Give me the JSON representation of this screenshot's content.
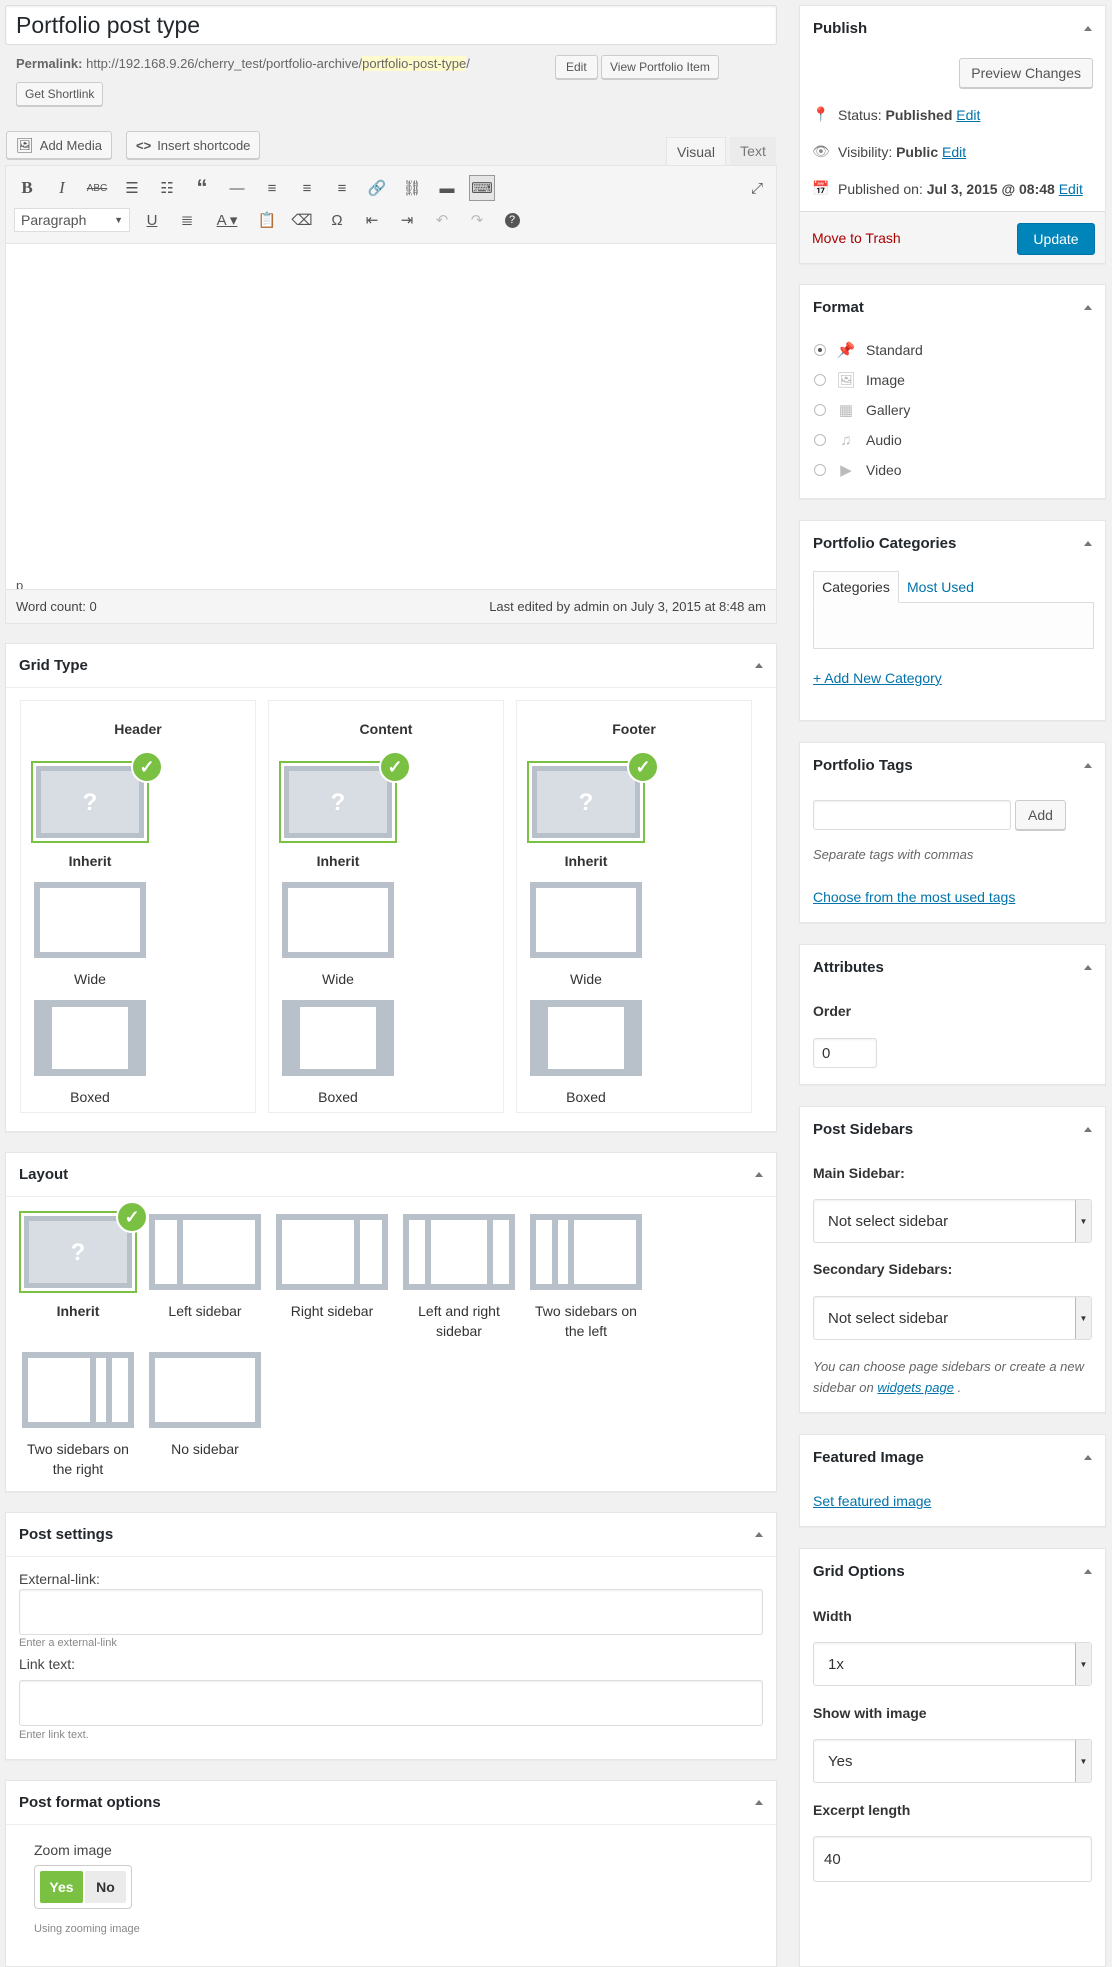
{
  "title": "Portfolio post type",
  "permalink": {
    "label": "Permalink:",
    "base": "http://192.168.9.26/cherry_test/portfolio-archive/",
    "slug": "portfolio-post-type",
    "trail": "/",
    "edit": "Edit",
    "view": "View Portfolio Item",
    "shortlink": "Get Shortlink"
  },
  "editor": {
    "add_media": "Add Media",
    "insert_shortcode": "Insert shortcode",
    "tab_visual": "Visual",
    "tab_text": "Text",
    "paragraph": "Paragraph",
    "path": "p",
    "word_count": "Word count: 0",
    "last_edited": "Last edited by admin on July 3, 2015 at 8:48 am"
  },
  "grid_type": {
    "title": "Grid Type",
    "columns": [
      {
        "name": "Header",
        "options": [
          "Inherit",
          "Wide",
          "Boxed"
        ]
      },
      {
        "name": "Content",
        "options": [
          "Inherit",
          "Wide",
          "Boxed"
        ]
      },
      {
        "name": "Footer",
        "options": [
          "Inherit",
          "Wide",
          "Boxed"
        ]
      }
    ]
  },
  "layout": {
    "title": "Layout",
    "options": [
      "Inherit",
      "Left sidebar",
      "Right sidebar",
      "Left and right sidebar",
      "Two sidebars on the left",
      "Two sidebars on the right",
      "No sidebar"
    ]
  },
  "post_settings": {
    "title": "Post settings",
    "external_label": "External-link:",
    "external_hint": "Enter a external-link",
    "link_label": "Link text:",
    "link_hint": "Enter link text."
  },
  "post_format_options": {
    "title": "Post format options",
    "zoom_label": "Zoom image",
    "yes": "Yes",
    "no": "No",
    "hint": "Using zooming image"
  },
  "publish": {
    "title": "Publish",
    "preview": "Preview Changes",
    "status_label": "Status:",
    "status_value": "Published",
    "visibility_label": "Visibility:",
    "visibility_value": "Public",
    "published_label": "Published on:",
    "published_value": "Jul 3, 2015 @ 08:48",
    "edit": "Edit",
    "trash": "Move to Trash",
    "update": "Update"
  },
  "format": {
    "title": "Format",
    "options": [
      "Standard",
      "Image",
      "Gallery",
      "Audio",
      "Video"
    ],
    "selected": "Standard"
  },
  "categories": {
    "title": "Portfolio Categories",
    "tab_all": "Categories",
    "tab_used": "Most Used",
    "add": "+ Add New Category"
  },
  "tags": {
    "title": "Portfolio Tags",
    "add": "Add",
    "hint": "Separate tags with commas",
    "choose": "Choose from the most used tags"
  },
  "attributes": {
    "title": "Attributes",
    "order_label": "Order",
    "order_value": "0"
  },
  "sidebars": {
    "title": "Post Sidebars",
    "main_label": "Main Sidebar:",
    "main_value": "Not select sidebar",
    "secondary_label": "Secondary Sidebars:",
    "secondary_value": "Not select sidebar",
    "hint_pre": "You can choose page sidebars or create a new sidebar on",
    "hint_link": "widgets page",
    "hint_post": "."
  },
  "featured": {
    "title": "Featured Image",
    "link": "Set featured image"
  },
  "grid_options": {
    "title": "Grid Options",
    "width_label": "Width",
    "width_value": "1x",
    "show_label": "Show with image",
    "show_value": "Yes",
    "excerpt_label": "Excerpt length",
    "excerpt_value": "40"
  },
  "colors": {
    "accent": "#0085ba",
    "selected": "#7ac143",
    "trash": "#a00",
    "thumb": "#b8c0ca"
  }
}
